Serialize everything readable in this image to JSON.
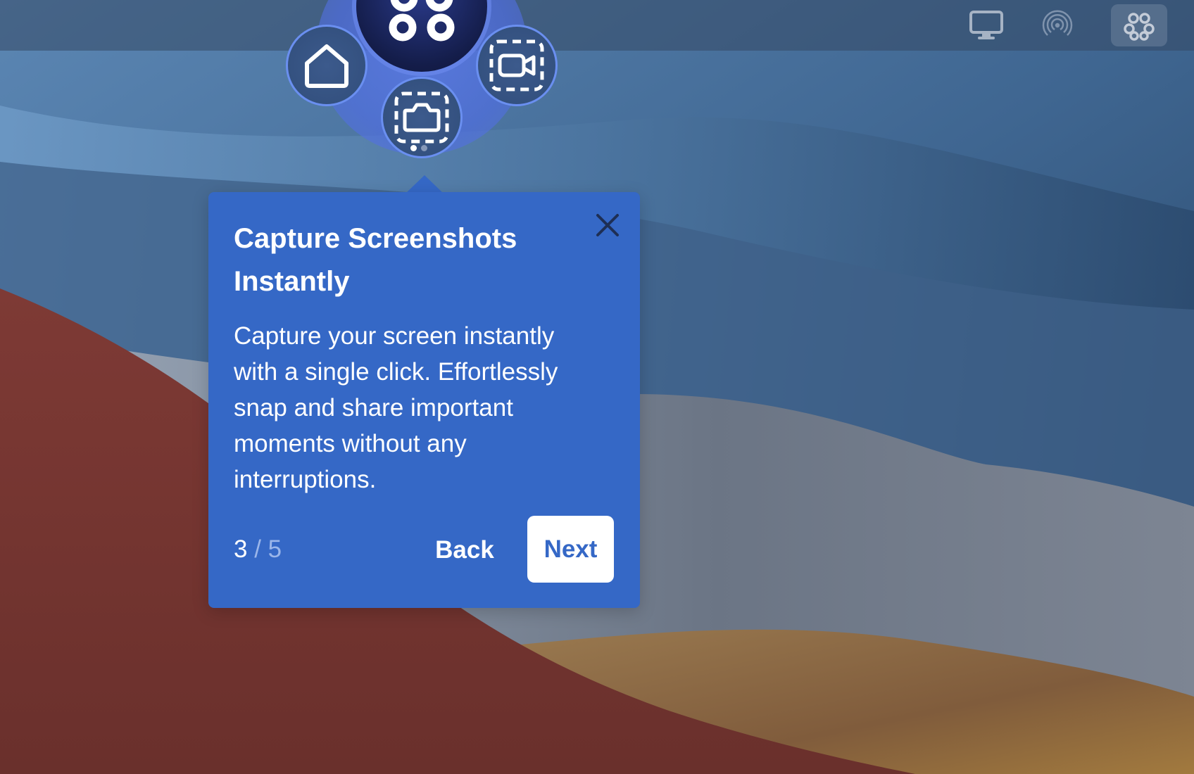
{
  "tooltip": {
    "title": "Capture Screenshots Instantly",
    "body": "Capture your screen instantly with a single click. Effortlessly snap and share important moments without any interruptions.",
    "current_step": "3",
    "separator": "/",
    "total_steps": "5",
    "back_label": "Back",
    "next_label": "Next"
  },
  "launcher": {
    "items": [
      "home-icon",
      "screenshot-icon",
      "screen-record-icon"
    ],
    "dots_total": 2,
    "dots_active": 1
  },
  "menubar": {
    "icons": [
      "display-icon",
      "airdrop-icon",
      "app-menu-icon"
    ]
  },
  "colors": {
    "tooltip_bg": "#3568c6",
    "next_text": "#3568c6",
    "halo": "#5a78e6"
  }
}
